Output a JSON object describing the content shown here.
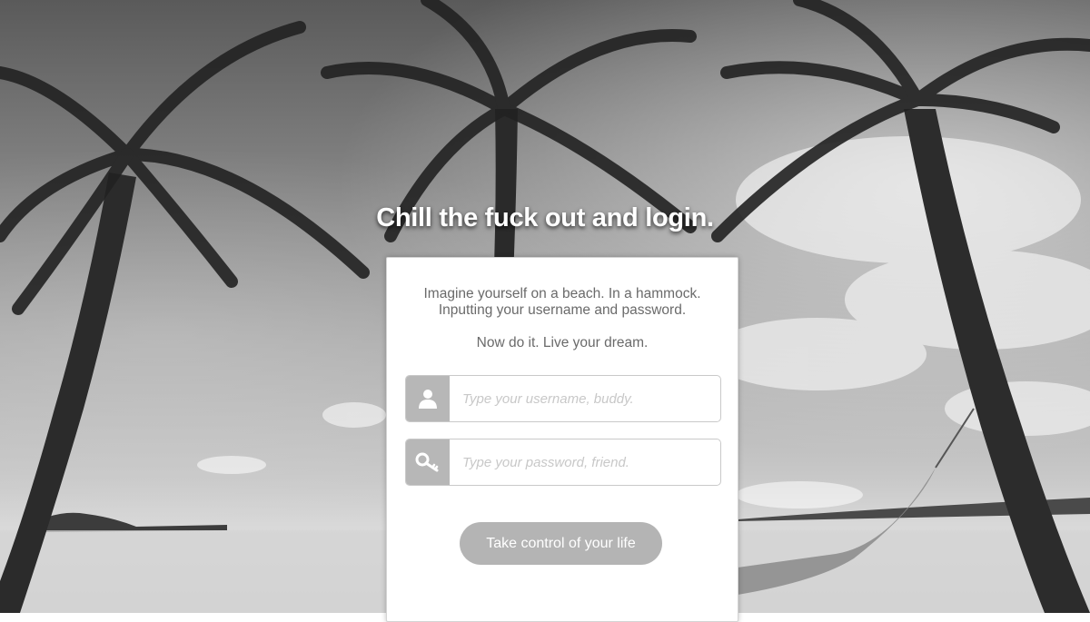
{
  "login": {
    "headline": "Chill the fuck out and login.",
    "intro_line1": "Imagine yourself on a beach. In a hammock.",
    "intro_line2": "Inputting your username and password.",
    "intro_line3": "Now do it. Live your dream.",
    "username": {
      "placeholder": "Type your username, buddy.",
      "value": "",
      "icon": "user-icon"
    },
    "password": {
      "placeholder": "Type your password, friend.",
      "value": "",
      "icon": "key-icon"
    },
    "submit_label": "Take control of your life"
  },
  "colors": {
    "accent_gray": "#b4b4b4",
    "icon_box": "#b7b7b7",
    "text_gray": "#6a6a6a",
    "headline_text": "#ffffff"
  }
}
